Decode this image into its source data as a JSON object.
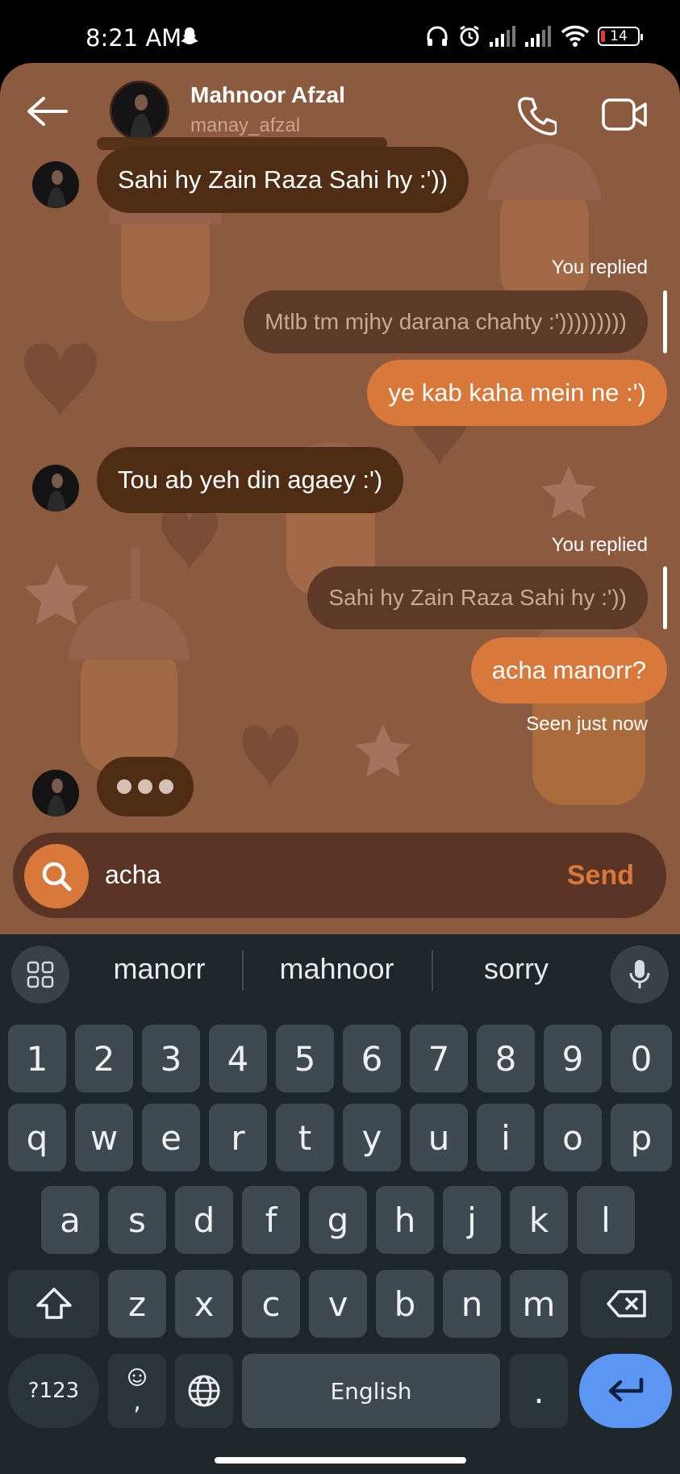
{
  "status_bar": {
    "time": "8:21 AM",
    "battery": "14",
    "icons": [
      "snapchat-icon",
      "headphones-icon",
      "alarm-icon",
      "signal-icon",
      "signal-icon",
      "wifi-icon",
      "battery-icon"
    ]
  },
  "header": {
    "name": "Mahnoor Afzal",
    "username": "manay_afzal"
  },
  "messages": [
    {
      "dir": "in",
      "text": "Sahi hy Zain Raza Sahi hy :'))"
    },
    {
      "dir": "meta",
      "text": "You replied"
    },
    {
      "dir": "reply",
      "text": "Mtlb tm mjhy darana chahty :')))))))))"
    },
    {
      "dir": "out",
      "text": "ye kab kaha mein ne :')"
    },
    {
      "dir": "in",
      "text": "Tou ab yeh din agaey :')"
    },
    {
      "dir": "meta",
      "text": "You replied"
    },
    {
      "dir": "reply",
      "text": "Sahi hy Zain Raza Sahi hy :'))"
    },
    {
      "dir": "out",
      "text": "acha manorr?"
    },
    {
      "dir": "meta",
      "text": "Seen just now"
    }
  ],
  "composer": {
    "value": "acha",
    "send_label": "Send"
  },
  "keyboard": {
    "suggestions": [
      "manorr",
      "mahnoor",
      "sorry"
    ],
    "row_numbers": [
      "1",
      "2",
      "3",
      "4",
      "5",
      "6",
      "7",
      "8",
      "9",
      "0"
    ],
    "row_q": [
      "q",
      "w",
      "e",
      "r",
      "t",
      "y",
      "u",
      "i",
      "o",
      "p"
    ],
    "row_a": [
      "a",
      "s",
      "d",
      "f",
      "g",
      "h",
      "j",
      "k",
      "l"
    ],
    "row_z": [
      "z",
      "x",
      "c",
      "v",
      "b",
      "n",
      "m"
    ],
    "symbols_label": "?123",
    "comma_label": ",",
    "space_label": "English",
    "period_label": "."
  },
  "colors": {
    "wallpaper": "#8b5a3f",
    "incoming_bubble": "#4f2d14",
    "outgoing_bubble": "#d8783a",
    "keyboard_bg": "#20272b",
    "enter_key": "#5c96f5"
  }
}
